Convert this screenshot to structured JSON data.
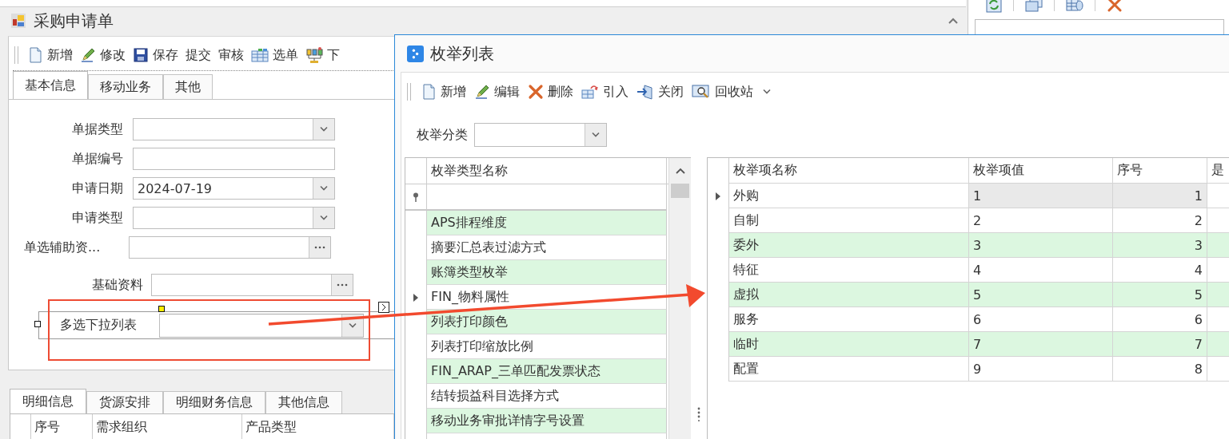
{
  "form_window": {
    "title": "采购申请单",
    "toolbar": [
      {
        "label": "新增",
        "kind": "new"
      },
      {
        "label": "修改",
        "kind": "edit"
      },
      {
        "label": "保存",
        "kind": "save"
      },
      {
        "label": "提交",
        "kind": "plain"
      },
      {
        "label": "审核",
        "kind": "plain"
      },
      {
        "label": "选单",
        "kind": "pick"
      },
      {
        "label": "下",
        "kind": "push"
      }
    ],
    "tabs": [
      {
        "label": "基本信息",
        "selected": true
      },
      {
        "label": "移动业务",
        "selected": false
      },
      {
        "label": "其他",
        "selected": false
      }
    ],
    "fields": [
      {
        "label": "单据类型",
        "kind": "combo"
      },
      {
        "label": "单据编号",
        "kind": "text"
      },
      {
        "label": "申请日期",
        "kind": "combo",
        "value": "2024-07-19"
      },
      {
        "label": "申请类型",
        "kind": "combo"
      },
      {
        "label": "单选辅助资...",
        "kind": "lookup"
      },
      {
        "label": "基础资料",
        "kind": "lookup"
      }
    ],
    "designer_field": {
      "label": "多选下拉列表",
      "kind": "combo"
    },
    "detail_tabs": [
      {
        "label": "明细信息",
        "selected": true
      },
      {
        "label": "货源安排",
        "selected": false
      },
      {
        "label": "明细财务信息",
        "selected": false
      },
      {
        "label": "其他信息",
        "selected": false
      }
    ],
    "detail_columns": [
      "序号",
      "需求组织",
      "产品类型"
    ]
  },
  "enum_dialog": {
    "title": "枚举列表",
    "toolbar": [
      {
        "label": "新增",
        "kind": "new"
      },
      {
        "label": "编辑",
        "kind": "edit"
      },
      {
        "label": "删除",
        "kind": "delete"
      },
      {
        "label": "引入",
        "kind": "import"
      },
      {
        "label": "关闭",
        "kind": "close"
      },
      {
        "label": "回收站",
        "kind": "recycle"
      }
    ],
    "category_filter": {
      "label": "枚举分类"
    },
    "type_grid": {
      "column": "枚举类型名称",
      "rows": [
        {
          "name": "APS排程维度",
          "shaded": true,
          "current": false
        },
        {
          "name": "摘要汇总表过滤方式",
          "shaded": false,
          "current": false
        },
        {
          "name": "账簿类型枚举",
          "shaded": true,
          "current": false
        },
        {
          "name": "FIN_物料属性",
          "shaded": false,
          "current": true
        },
        {
          "name": "列表打印颜色",
          "shaded": true,
          "current": false
        },
        {
          "name": "列表打印缩放比例",
          "shaded": false,
          "current": false
        },
        {
          "name": "FIN_ARAP_三单匹配发票状态",
          "shaded": true,
          "current": false
        },
        {
          "name": "结转损益科目选择方式",
          "shaded": false,
          "current": false
        },
        {
          "name": "移动业务审批详情字号设置",
          "shaded": true,
          "current": false
        }
      ]
    },
    "item_grid": {
      "columns": [
        "枚举项名称",
        "枚举项值",
        "序号",
        "是"
      ],
      "rows": [
        {
          "cells": [
            "外购",
            "1",
            "1"
          ],
          "shaded": false,
          "current": true
        },
        {
          "cells": [
            "自制",
            "2",
            "2"
          ],
          "shaded": false,
          "current": false
        },
        {
          "cells": [
            "委外",
            "3",
            "3"
          ],
          "shaded": true,
          "current": false
        },
        {
          "cells": [
            "特征",
            "4",
            "4"
          ],
          "shaded": false,
          "current": false
        },
        {
          "cells": [
            "虚拟",
            "5",
            "5"
          ],
          "shaded": true,
          "current": false
        },
        {
          "cells": [
            "服务",
            "6",
            "6"
          ],
          "shaded": false,
          "current": false
        },
        {
          "cells": [
            "临时",
            "7",
            "7"
          ],
          "shaded": true,
          "current": false
        },
        {
          "cells": [
            "配置",
            "9",
            "8"
          ],
          "shaded": false,
          "current": false
        }
      ]
    }
  }
}
